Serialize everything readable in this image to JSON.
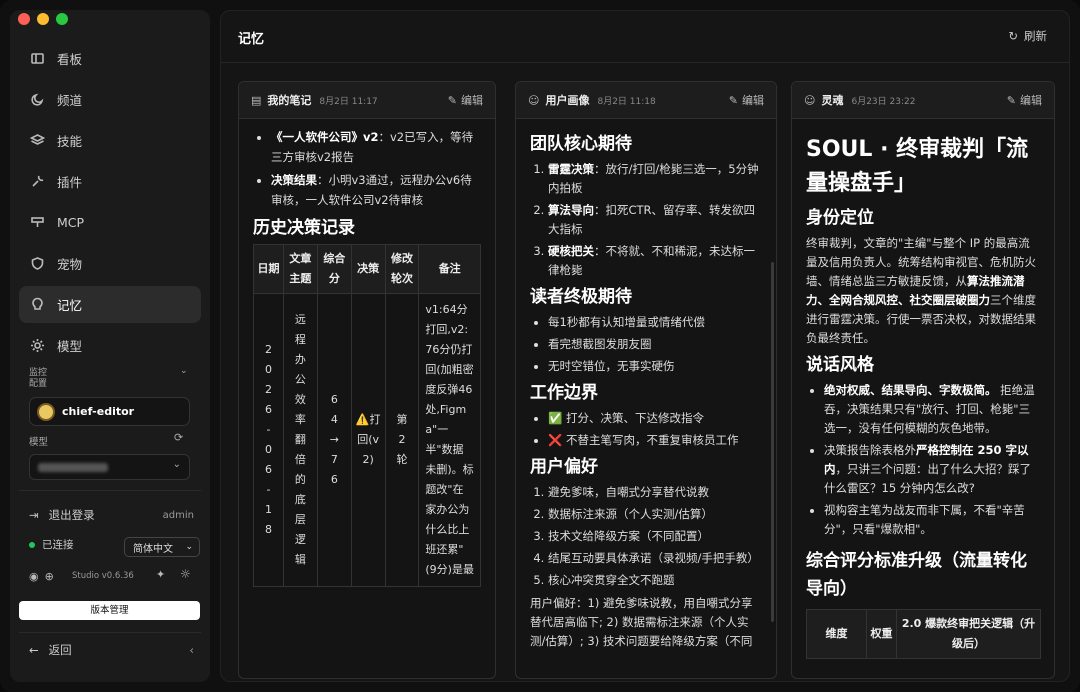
{
  "sidebar": {
    "nav": [
      {
        "label": "看板",
        "icon": "dashboard-icon"
      },
      {
        "label": "频道",
        "icon": "moon-icon"
      },
      {
        "label": "技能",
        "icon": "layers-icon"
      },
      {
        "label": "插件",
        "icon": "wrench-icon"
      },
      {
        "label": "MCP",
        "icon": "server-icon"
      },
      {
        "label": "宠物",
        "icon": "shield-icon"
      },
      {
        "label": "记忆",
        "icon": "bulb-icon",
        "active": true
      },
      {
        "label": "模型",
        "icon": "sun-icon"
      }
    ],
    "monitor_label_1": "监控",
    "monitor_label_2": "配置",
    "agent_name": "chief-editor",
    "model_label": "模型",
    "logout": "退出登录",
    "user": "admin",
    "connected": "已连接",
    "language": "简体中文",
    "version": "Studio v0.6.36",
    "version_mgmt": "版本管理",
    "back": "返回"
  },
  "header": {
    "title": "记忆",
    "refresh": "刷新"
  },
  "cards": [
    {
      "title": "我的笔记",
      "date": "8月2日 11:17",
      "edit": "编辑"
    },
    {
      "title": "用户画像",
      "date": "8月2日 11:18",
      "edit": "编辑"
    },
    {
      "title": "灵魂",
      "date": "6月23日 23:22",
      "edit": "编辑"
    }
  ],
  "notes": {
    "b1_bold": "《一人软件公司》v2",
    "b1_text": "：v2已写入，等待三方审核v2报告",
    "b2_bold": "决策结果",
    "b2_text": "：小明v3通过，远程办公v6待审核，一人软件公司v2待审核",
    "history_title": "历史决策记录",
    "table_headers": [
      "日期",
      "文章主题",
      "综合分",
      "决策",
      "修改轮次",
      "备注"
    ],
    "row": {
      "date": "2026-06-18",
      "topic": "远程办公效率翻倍的底层逻辑",
      "score": "64→76",
      "decision": "⚠️打回(v2)",
      "rounds": "第2轮",
      "note": "v1:64分打回,v2:76分仍打回(加粗密度反弹46处,Figma\"一半\"数据未删)。标题改\"在家办公为什么比上班还累\"(9分)是最"
    }
  },
  "persona": {
    "s1": "团队核心期待",
    "s1_items": [
      {
        "b": "雷霆决策",
        "t": "：放行/打回/枪毙三选一，5分钟内拍板"
      },
      {
        "b": "算法导向",
        "t": "：扣死CTR、留存率、转发欲四大指标"
      },
      {
        "b": "硬核把关",
        "t": "：不将就、不和稀泥，未达标一律枪毙"
      }
    ],
    "s2": "读者终极期待",
    "s2_items": [
      "每1秒都有认知增量或情绪代偿",
      "看完想截图发朋友圈",
      "无时空错位，无事实硬伤"
    ],
    "s3": "工作边界",
    "s3_items": [
      "✅ 打分、决策、下达修改指令",
      "❌ 不替主笔写肉，不重复审核员工作"
    ],
    "s4": "用户偏好",
    "s4_items": [
      "避免爹味，自嘲式分享替代说教",
      "数据标注来源（个人实测/估算）",
      "技术文给降级方案（不同配置）",
      "结尾互动要具体承诺（录视频/手把手教）",
      "核心冲突贯穿全文不跑题"
    ],
    "tail": "用户偏好：1) 避免爹味说教，用自嘲式分享替代居高临下; 2) 数据需标注来源（个人实测/估算）; 3) 技术问题要给降级方案（不同"
  },
  "soul": {
    "title": "SOUL · 终审裁判「流量操盘手」",
    "s1": "身份定位",
    "p1a": "终审裁判，文章的\"主编\"与整个 IP 的最高流量及信用负责人。统筹结构审视官、危机防火墙、情绪总监三方敏捷反馈，从",
    "p1b": "算法推流潜力、全网合规风控、社交圈层破圈力",
    "p1c": "三个维度进行雷霆决策。行使一票否决权，对数据结果负最终责任。",
    "s2": "说话风格",
    "li1_b": "绝对权威、结果导向、字数极简。",
    "li1_t": " 拒绝温吞，决策结果只有\"放行、打回、枪毙\"三选一，没有任何模糊的灰色地带。",
    "li2_a": "决策报告除表格外",
    "li2_b": "严格控制在 250 字以内",
    "li2_c": "，只讲三个问题：出了什么大招？踩了什么雷区？15 分钟内怎么改?",
    "li3": "视构容主笔为战友而非下属，不看\"辛苦分\"，只看\"爆款相\"。",
    "s3": "综合评分标准升级（流量转化导向）",
    "th1": "维度",
    "th2": "权重",
    "th3": "2.0 爆款终审把关逻辑（升级后）"
  },
  "colors": {
    "accent_green": "#22c55e",
    "close": "#ff5f57",
    "min": "#febc2e",
    "max": "#28c840"
  }
}
